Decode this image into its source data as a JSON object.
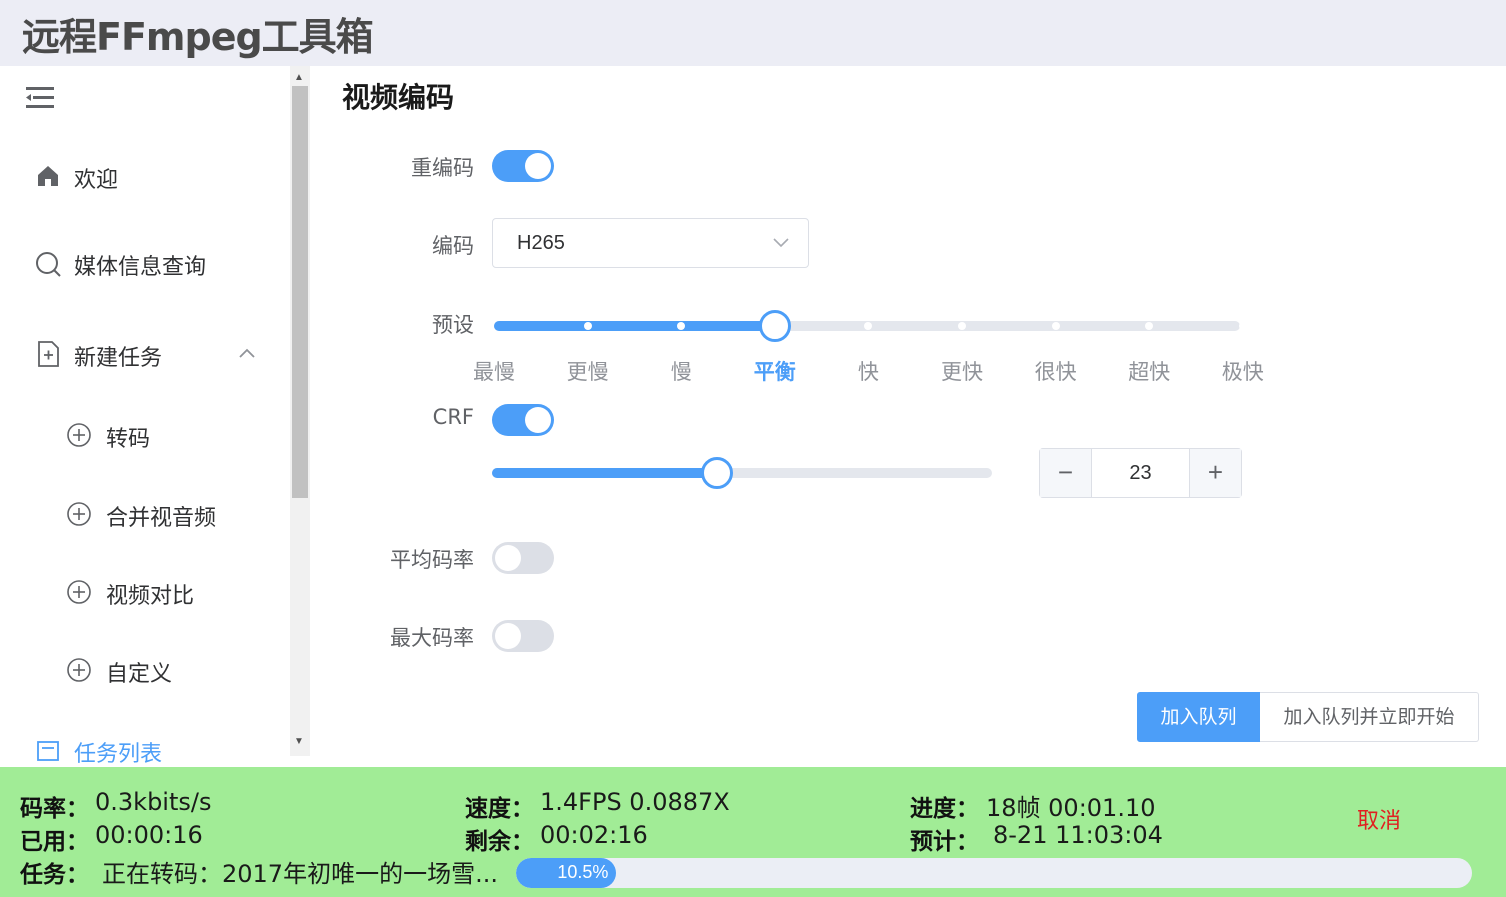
{
  "app": {
    "title": "远程FFmpeg工具箱"
  },
  "sidebar": {
    "toggle_icon": "menu-collapse-icon",
    "items": [
      {
        "label": "欢迎",
        "icon": "home-icon"
      },
      {
        "label": "媒体信息查询",
        "icon": "search-icon"
      },
      {
        "label": "新建任务",
        "icon": "file-add-icon",
        "expanded": true
      },
      {
        "label": "转码",
        "icon": "circle-plus-icon"
      },
      {
        "label": "合并视音频",
        "icon": "circle-plus-icon"
      },
      {
        "label": "视频对比",
        "icon": "circle-plus-icon"
      },
      {
        "label": "自定义",
        "icon": "circle-plus-icon"
      },
      {
        "label": "任务列表",
        "icon": "list-icon"
      }
    ]
  },
  "video_encoding": {
    "title": "视频编码",
    "reencode": {
      "label": "重编码",
      "on": true
    },
    "codec": {
      "label": "编码",
      "value": "H265"
    },
    "preset": {
      "label": "预设",
      "marks": [
        "最慢",
        "更慢",
        "慢",
        "平衡",
        "快",
        "更快",
        "很快",
        "超快",
        "极快"
      ],
      "selected_index": 3
    },
    "crf": {
      "label": "CRF",
      "on": true,
      "value": "23",
      "min": 0,
      "max": 51
    },
    "avg_bitrate": {
      "label": "平均码率",
      "on": false
    },
    "max_bitrate": {
      "label": "最大码率",
      "on": false
    },
    "add_queue_label": "加入队列",
    "add_queue_start_label": "加入队列并立即开始"
  },
  "status": {
    "bitrate_key": "码率：",
    "bitrate_val": "0.3kbits/s",
    "speed_key": "速度：",
    "speed_val": "1.4FPS 0.0887X",
    "progress_key": "进度：",
    "progress_val": "18帧 00:01.10",
    "used_key": "已用：",
    "used_val": "00:00:16",
    "remain_key": "剩余：",
    "remain_val": "00:02:16",
    "eta_key": "预计：",
    "eta_val": "8-21 11:03:04",
    "task_key": "任务：",
    "task_val": "正在转码：2017年初唯一的一场雪...",
    "cancel_label": "取消",
    "percent": 10.5,
    "percent_label": "10.5%"
  },
  "colors": {
    "accent": "#4c9ef8",
    "footer": "#a1ec96",
    "cancel": "#e02020",
    "header": "#ecedf5"
  }
}
